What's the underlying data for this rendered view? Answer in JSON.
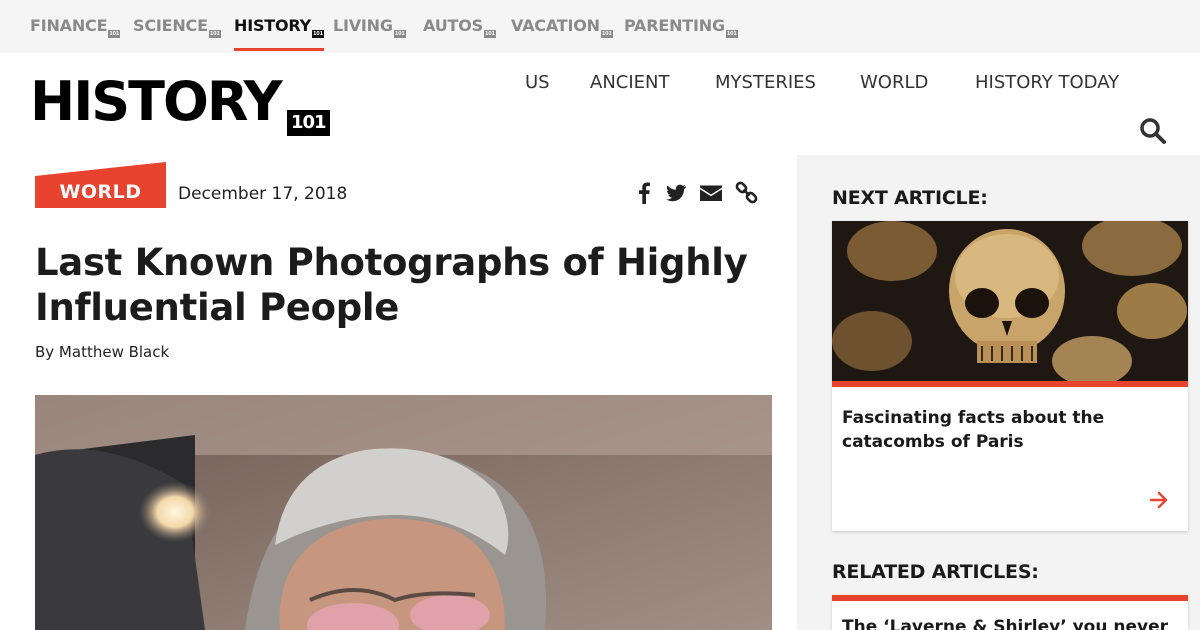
{
  "network_nav": [
    {
      "label": "FINANCE",
      "badge": "101"
    },
    {
      "label": "SCIENCE",
      "badge": "101"
    },
    {
      "label": "HISTORY",
      "badge": "101",
      "active": true
    },
    {
      "label": "LIVING",
      "badge": "101"
    },
    {
      "label": "AUTOS",
      "badge": "101"
    },
    {
      "label": "VACATION",
      "badge": "101"
    },
    {
      "label": "PARENTING",
      "badge": "101"
    }
  ],
  "logo": {
    "text": "HISTORY",
    "badge": "101"
  },
  "main_nav": [
    "US",
    "ANCIENT",
    "MYSTERIES",
    "WORLD",
    "HISTORY TODAY"
  ],
  "search": {
    "icon": "search-icon"
  },
  "article": {
    "category": "WORLD",
    "date": "December 17, 2018",
    "title_line1": "Last Known Photographs of Highly",
    "title_line2": "Influential People",
    "byline": "By Matthew Black",
    "share_icons": [
      "facebook-icon",
      "twitter-icon",
      "email-icon",
      "link-icon"
    ]
  },
  "sidebar": {
    "next_heading": "NEXT ARTICLE:",
    "next_title": "Fascinating facts about the catacombs of Paris",
    "related_heading": "RELATED ARTICLES:",
    "related_title": "The ‘Laverne & Shirley’ you never"
  },
  "colors": {
    "accent": "#e8432e",
    "nav_inactive": "#8a8a8a",
    "sidebar_bg": "#f3f3f3"
  }
}
